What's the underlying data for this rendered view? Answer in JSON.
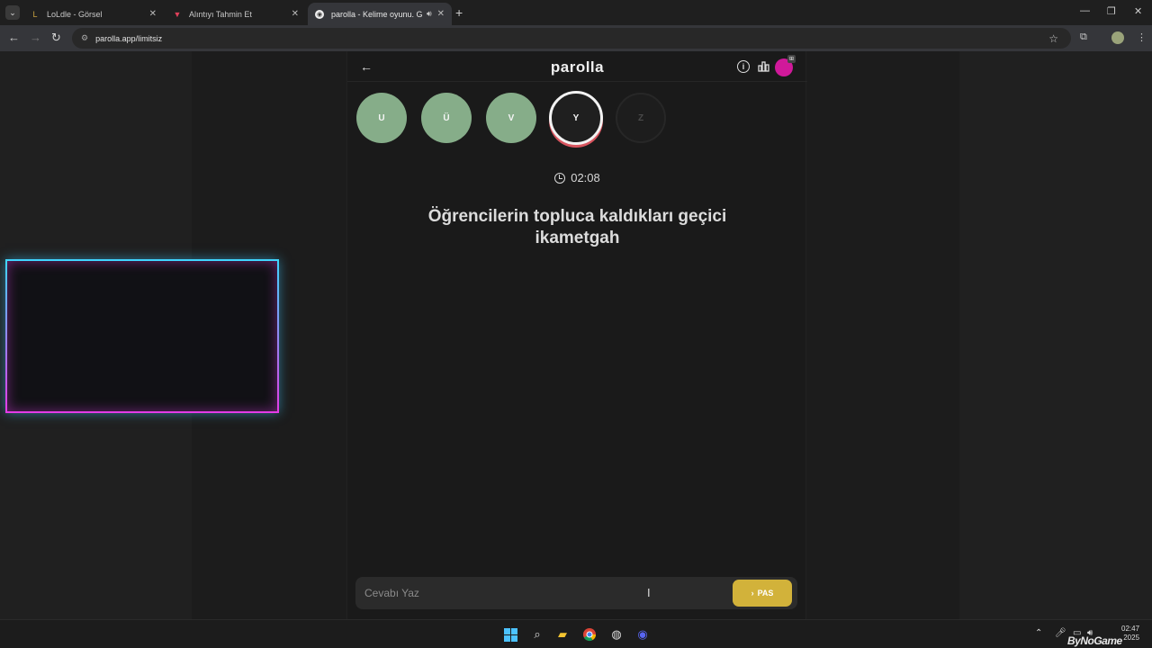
{
  "browser": {
    "tabs": [
      {
        "title": "LoLdle - Görsel",
        "favicon": "L",
        "active": false
      },
      {
        "title": "Alıntıyı Tahmin Et",
        "favicon": "v-icon",
        "active": false
      },
      {
        "title": "parolla - Kelime oyunu. Gün",
        "favicon": "p-icon",
        "active": true
      }
    ],
    "url": "parolla.app/limitsiz"
  },
  "app": {
    "title": "parolla",
    "letters": [
      {
        "char": "U",
        "state": "done"
      },
      {
        "char": "Ü",
        "state": "done"
      },
      {
        "char": "V",
        "state": "done"
      },
      {
        "char": "Y",
        "state": "current"
      },
      {
        "char": "Z",
        "state": "pending"
      }
    ],
    "timer": "02:08",
    "question": "Öğrencilerin topluca kaldıkları geçici ikametgah",
    "answer_placeholder": "Cevabı Yaz",
    "pass_label": "PAS"
  },
  "taskbar": {
    "time": "02:47",
    "date": "2025",
    "watermark": "ByNoGame"
  },
  "colors": {
    "done": "#86ad89",
    "current_ring": "#d8555f",
    "pass_button": "#d2b23a",
    "avatar": "#d0199a"
  }
}
